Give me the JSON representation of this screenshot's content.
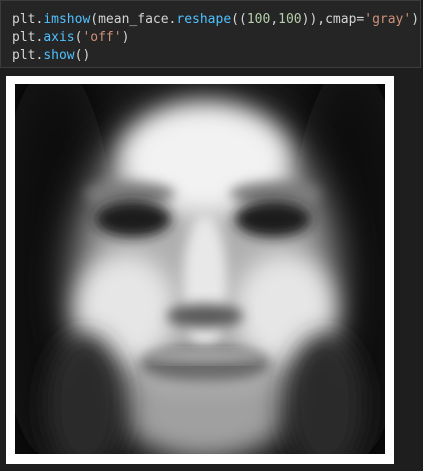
{
  "code_cell": {
    "line1": {
      "obj": "plt",
      "dot1": ".",
      "fn": "imshow",
      "open": "(mean_face.",
      "fn2": "reshape",
      "open2": "((",
      "num1": "100",
      "comma": ",",
      "num2": "100",
      "close": ")),cmap=",
      "str": "'gray'",
      "end": ")"
    },
    "line2": {
      "obj": "plt",
      "dot": ".",
      "fn": "axis",
      "open": "(",
      "str": "'off'",
      "close": ")"
    },
    "line3": {
      "obj": "plt",
      "dot": ".",
      "fn": "show",
      "paren": "()"
    }
  },
  "output": {
    "image_description_icon": "mean-face-grayscale-image",
    "colormap": "gray",
    "shape": [
      100,
      100
    ],
    "axis": "off"
  },
  "colors": {
    "background": "#1e1e1e",
    "cell_background": "#252526",
    "function": "#4fc1ff",
    "number": "#b5cea8",
    "string": "#ce9178",
    "text": "#d4d4d4",
    "figure_frame": "#ffffff"
  }
}
